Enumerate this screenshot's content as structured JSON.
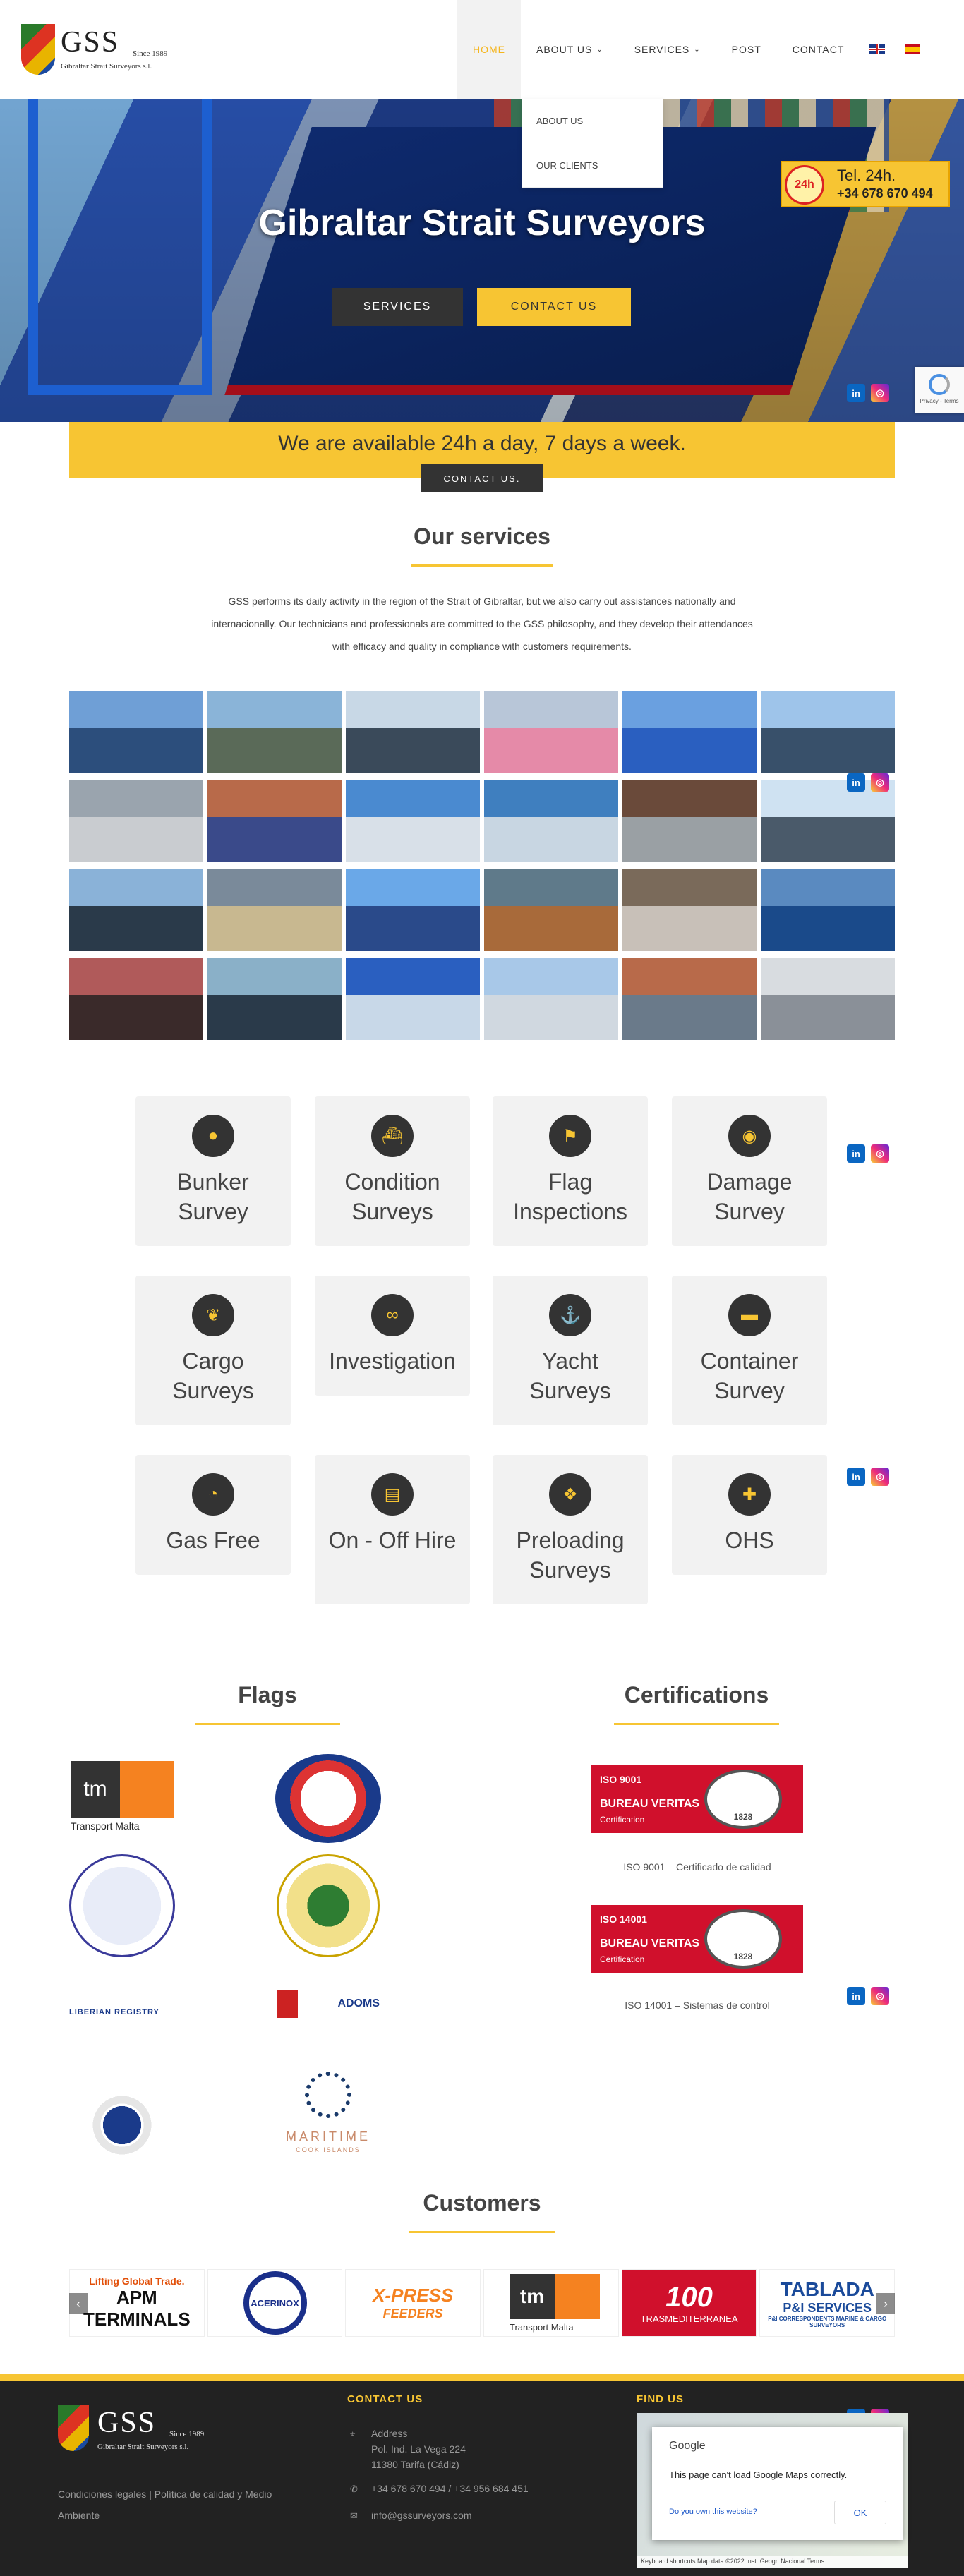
{
  "header": {
    "logo_text": "GSS",
    "logo_since": "Since 1989",
    "logo_subtitle": "Gibraltar Strait Surveyors s.l.",
    "nav": [
      {
        "label": "HOME",
        "active": true
      },
      {
        "label": "ABOUT US",
        "has_dropdown": true
      },
      {
        "label": "SERVICES",
        "has_dropdown": true
      },
      {
        "label": "POST"
      },
      {
        "label": "CONTACT"
      }
    ],
    "submenu": [
      "ABOUT US",
      "OUR CLIENTS"
    ],
    "lang_icons": [
      "flag-uk-icon",
      "flag-es-icon"
    ]
  },
  "hero": {
    "title": "Gibraltar Strait Surveyors",
    "services_button": "SERVICES",
    "contact_button": "CONTACT US",
    "phone_badge_icon": "24h",
    "phone_line1": "Tel. 24h.",
    "phone_line2": "+34 678 670 494"
  },
  "social": {
    "linkedin": "in",
    "instagram": "◎"
  },
  "recaptcha": {
    "text": "Privacy - Terms"
  },
  "availability": {
    "text": "We are available 24h a day, 7 days a week.",
    "button": "CONTACT US."
  },
  "services": {
    "title": "Our services",
    "description": "GSS performs its daily activity in the region of the Strait of Gibraltar, but we also carry out assistances nationally and internacionally. Our technicians and professionals are committed to the GSS philosophy, and they develop their attendances with efficacy and quality in compliance with customers requirements.",
    "gallery_count": 24,
    "cards": [
      {
        "label": "Bunker Survey",
        "icon": "droplet-icon"
      },
      {
        "label": "Condition Surveys",
        "icon": "ship-icon"
      },
      {
        "label": "Flag Inspections",
        "icon": "flag-icon"
      },
      {
        "label": "Damage Survey",
        "icon": "eye-icon"
      },
      {
        "label": "Cargo Surveys",
        "icon": "leaf-icon"
      },
      {
        "label": "Investigation",
        "icon": "binoculars-icon"
      },
      {
        "label": "Yacht Surveys",
        "icon": "anchor-icon"
      },
      {
        "label": "Container Survey",
        "icon": "truck-icon"
      },
      {
        "label": "Gas Free",
        "icon": "gauge-icon"
      },
      {
        "label": "On - Off Hire",
        "icon": "clipboard-icon"
      },
      {
        "label": "Preloading Surveys",
        "icon": "cubes-icon"
      },
      {
        "label": "OHS",
        "icon": "plus-square-icon"
      }
    ]
  },
  "flags": {
    "title": "Flags",
    "logos": [
      {
        "name": "Transport Malta",
        "mark": "tm"
      },
      {
        "name": "Autoridad Marítima de Panamá"
      },
      {
        "name": "Marshall Islands seal"
      },
      {
        "name": "Saint Kitts seal"
      },
      {
        "name": "LIBERIAN REGISTRY"
      },
      {
        "name": "ADOMS"
      },
      {
        "name": "Tuvalu seal"
      },
      {
        "name": "MARITIME",
        "sub": "COOK ISLANDS"
      }
    ]
  },
  "certifications": {
    "title": "Certifications",
    "items": [
      {
        "code": "ISO 9001",
        "org": "BUREAU VERITAS",
        "type": "Certification",
        "year": "1828",
        "caption": "ISO 9001 – Certificado de calidad"
      },
      {
        "code": "ISO 14001",
        "org": "BUREAU VERITAS",
        "type": "Certification",
        "year": "1828",
        "caption": "ISO 14001 – Sistemas de control"
      }
    ]
  },
  "customers": {
    "title": "Customers",
    "logos": [
      {
        "line1": "Lifting Global Trade.",
        "line2": "APM",
        "line3": "TERMINALS"
      },
      {
        "line1": "ACERINOX"
      },
      {
        "line1": "X-PRESS",
        "line2": "FEEDERS"
      },
      {
        "line1": "tm",
        "line2": "Transport Malta"
      },
      {
        "line1": "100",
        "line2": "TRASMEDITERRANEA"
      },
      {
        "line1": "TABLADA",
        "line2": "P&I SERVICES",
        "line3": "P&I CORRESPONDENTS MARINE & CARGO SURVEYORS"
      }
    ],
    "prev": "‹",
    "next": "›"
  },
  "footer": {
    "logo_text": "GSS",
    "logo_since": "Since 1989",
    "logo_subtitle": "Gibraltar Strait Surveyors s.l.",
    "legal_link": "Condiciones legales",
    "separator": " | ",
    "quality_link": "Política de calidad y Medio Ambiente",
    "contact_title": "CONTACT US",
    "address_label": "Address",
    "address_line1": "Pol. Ind. La Vega 224",
    "address_line2": "11380 Tarifa (Cádiz)",
    "phone": "+34 678 670 494 / +34 956 684 451",
    "email": "info@gssurveyors.com",
    "find_title": "FIND US",
    "map_brand": "Google",
    "map_error": "This page can't load Google Maps correctly.",
    "map_question": "Do you own this website?",
    "map_ok": "OK",
    "map_footer": "Keyboard shortcuts   Map data ©2022 Inst. Geogr. Nacional   Terms"
  },
  "colors": {
    "accent": "#f7c533",
    "dark": "#333333",
    "footer": "#222222"
  }
}
